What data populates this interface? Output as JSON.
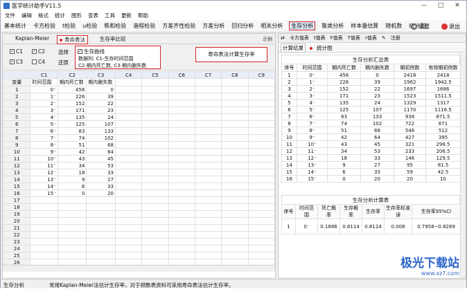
{
  "window": {
    "title": "医学统计助手V11.5",
    "min": "—",
    "max": "□",
    "close": "✕"
  },
  "menu": [
    "文件",
    "编辑",
    "格式",
    "统计",
    "图形",
    "查表",
    "工具",
    "更新",
    "帮助"
  ],
  "toolbar": {
    "items": [
      "基本统计",
      "卡方检验",
      "t检验",
      "u检验",
      "秩和检验",
      "谐程检验",
      "方差齐性检验",
      "方差分析",
      "回归分析",
      "相关分析",
      "生存分析",
      "聚类分析",
      "样本量估算",
      "随机数",
      "统计图"
    ],
    "active": "生存分析",
    "settings": "设置",
    "exit": "退出"
  },
  "left": {
    "tab_km": "Kaplan-Meier",
    "tab_life": "寿命表法",
    "tab_compare": "生存率比较",
    "example": "示例",
    "cols": [
      {
        "label": "C1",
        "checked": true
      },
      {
        "label": "C2",
        "checked": true
      },
      {
        "label": "C3",
        "checked": true
      },
      {
        "label": "C4",
        "checked": false
      }
    ],
    "select_label": "选择",
    "restore_label": "还原",
    "curve_label": "生存曲线",
    "data_cols_line1": "数据列: C1-生存时间范围",
    "data_cols_line2": "C2-期内死亡数, C3-期内删失数",
    "calc_button": "寿命表法计算生存率",
    "grid": {
      "col_headers": [
        "C1",
        "C2",
        "C3",
        "C4",
        "C5",
        "C6",
        "C7",
        "C8",
        "C9"
      ],
      "var_header": "变量",
      "field_names": [
        "时间范围",
        "期内死亡数",
        "期内删失数"
      ],
      "rows": [
        [
          "0⁻",
          "456",
          "0"
        ],
        [
          "1⁻",
          "226",
          "39"
        ],
        [
          "2⁻",
          "152",
          "22"
        ],
        [
          "3⁻",
          "171",
          "23"
        ],
        [
          "4⁻",
          "135",
          "24"
        ],
        [
          "5⁻",
          "125",
          "107"
        ],
        [
          "6⁻",
          "83",
          "133"
        ],
        [
          "7⁻",
          "74",
          "102"
        ],
        [
          "8⁻",
          "51",
          "68"
        ],
        [
          "9⁻",
          "42",
          "64"
        ],
        [
          "10⁻",
          "43",
          "45"
        ],
        [
          "11⁻",
          "34",
          "53"
        ],
        [
          "12⁻",
          "18",
          "33"
        ],
        [
          "13⁻",
          "9",
          "27"
        ],
        [
          "14⁻",
          "6",
          "33"
        ],
        [
          "15⁻",
          "0",
          "20"
        ]
      ]
    }
  },
  "right": {
    "tabs": [
      "卡方值表",
      "t值表",
      "F值表",
      "T值表",
      "r值表",
      "注册"
    ],
    "subtab_result": "计算结果",
    "subtab_chart": "统计图",
    "summary": {
      "title": "生存分析汇总表",
      "headers": [
        "序号",
        "时间范围",
        "期内死亡数",
        "期内删失数",
        "期初例数",
        "有效期初例数"
      ],
      "rows": [
        [
          "1",
          "0⁻",
          "456",
          "0",
          "2418",
          "2418"
        ],
        [
          "2",
          "1⁻",
          "226",
          "39",
          "1962",
          "1942.5"
        ],
        [
          "3",
          "2⁻",
          "152",
          "22",
          "1697",
          "1686"
        ],
        [
          "4",
          "3⁻",
          "171",
          "23",
          "1523",
          "1511.5"
        ],
        [
          "5",
          "4⁻",
          "135",
          "24",
          "1329",
          "1317"
        ],
        [
          "6",
          "5⁻",
          "125",
          "107",
          "1170",
          "1116.5"
        ],
        [
          "7",
          "6⁻",
          "83",
          "133",
          "938",
          "871.5"
        ],
        [
          "8",
          "7⁻",
          "74",
          "102",
          "722",
          "671"
        ],
        [
          "9",
          "8⁻",
          "51",
          "68",
          "546",
          "512"
        ],
        [
          "10",
          "9⁻",
          "42",
          "64",
          "427",
          "395"
        ],
        [
          "11",
          "10⁻",
          "43",
          "45",
          "321",
          "298.5"
        ],
        [
          "12",
          "11⁻",
          "34",
          "53",
          "233",
          "206.5"
        ],
        [
          "13",
          "12⁻",
          "18",
          "33",
          "146",
          "129.5"
        ],
        [
          "14",
          "13⁻",
          "9",
          "27",
          "95",
          "81.5"
        ],
        [
          "15",
          "14⁻",
          "6",
          "33",
          "59",
          "42.5"
        ],
        [
          "16",
          "15⁻",
          "0",
          "20",
          "20",
          "10"
        ]
      ]
    },
    "calc": {
      "title": "生存分析计算表",
      "headers": [
        "序号",
        "时间范围",
        "死亡概率",
        "生存概率",
        "生存率",
        "生存率标准误",
        "生存率95%CI"
      ],
      "rows": [
        [
          "1",
          "0⁻",
          "0.1886",
          "0.8114",
          "0.8114",
          "0.008",
          "0.7958~0.8269"
        ]
      ]
    }
  },
  "status": {
    "left": "生存分析",
    "message": "常用Kaplan-Meier法估计生存率，对于频数表资料可采用寿命表法估计生存率。"
  },
  "watermark": {
    "main": "极光下载站",
    "sub": "www.xz7.com"
  }
}
